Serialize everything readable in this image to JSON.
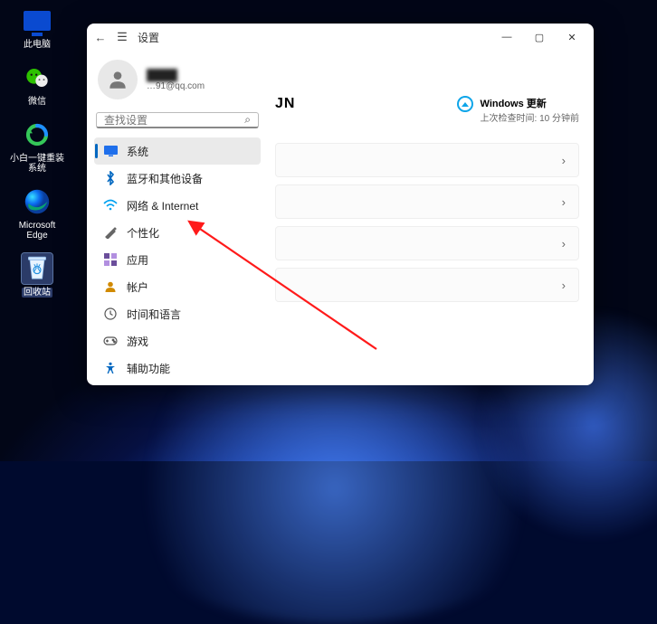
{
  "desktop_icons": [
    {
      "id": "this-pc",
      "label": "此电脑"
    },
    {
      "id": "wechat",
      "label": "微信"
    },
    {
      "id": "restore",
      "label": "小白一键重装系统"
    },
    {
      "id": "edge",
      "label": "Microsoft Edge"
    },
    {
      "id": "recycle",
      "label": "回收站"
    }
  ],
  "window": {
    "title": "设置",
    "controls": {
      "min": "—",
      "max": "▢",
      "close": "✕"
    },
    "back_icon": "←",
    "menu_icon": "☰"
  },
  "profile": {
    "name": "████",
    "email": "…91@qq.com"
  },
  "search": {
    "placeholder": "查找设置",
    "icon": "⌕"
  },
  "nav": {
    "items": [
      {
        "icon": "display",
        "color": "#1f6feb",
        "label": "系统",
        "active": true
      },
      {
        "icon": "bluetooth",
        "color": "#0067c0",
        "label": "蓝牙和其他设备",
        "active": false
      },
      {
        "icon": "wifi",
        "color": "#00a1f1",
        "label": "网络 & Internet",
        "active": false
      },
      {
        "icon": "brush",
        "color": "#8a6d3b",
        "label": "个性化",
        "active": false
      },
      {
        "icon": "apps",
        "color": "#6b4e9b",
        "label": "应用",
        "active": false
      },
      {
        "icon": "person",
        "color": "#d18a00",
        "label": "帐户",
        "active": false
      },
      {
        "icon": "clock",
        "color": "#10893e",
        "label": "时间和语言",
        "active": false
      },
      {
        "icon": "game",
        "color": "#107c10",
        "label": "游戏",
        "active": false
      },
      {
        "icon": "access",
        "color": "#0067c0",
        "label": "辅助功能",
        "active": false
      }
    ]
  },
  "main": {
    "title_fragment": "JN",
    "update_title": "Windows 更新",
    "update_sub": "上次检查时间: 10 分钟前"
  }
}
